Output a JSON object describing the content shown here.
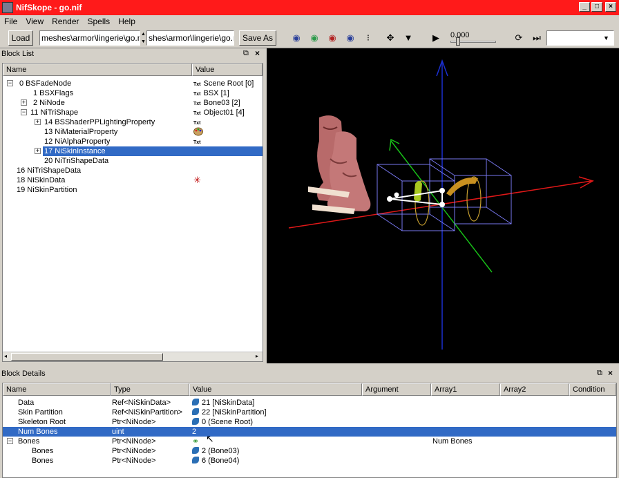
{
  "window": {
    "title": "NifSkope - go.nif"
  },
  "menu": [
    "File",
    "View",
    "Render",
    "Spells",
    "Help"
  ],
  "toolbar": {
    "load_label": "Load",
    "load_path": "meshes\\armor\\lingerie\\go.nif",
    "save_path": "shes\\armor\\lingerie\\go.nif",
    "save_label": "Save As",
    "time_value": "0.000"
  },
  "block_list": {
    "title": "Block List",
    "columns": [
      "Name",
      "Value"
    ],
    "rows": [
      {
        "name": "0  BSFadeNode",
        "value": "Scene Root [0]",
        "tag": "Txt"
      },
      {
        "name": "1  BSXFlags",
        "value": "BSX [1]",
        "tag": "Txt"
      },
      {
        "name": "2  NiNode",
        "value": "Bone03 [2]",
        "tag": "Txt"
      },
      {
        "name": "11  NiTriShape",
        "value": "Object01 [4]",
        "tag": "Txt"
      },
      {
        "name": "14  BSShaderPPLightingProperty",
        "value": "",
        "tag": "Txt"
      },
      {
        "name": "13  NiMaterialProperty",
        "value": "",
        "tag": ""
      },
      {
        "name": "12  NiAlphaProperty",
        "value": "",
        "tag": "Txt"
      },
      {
        "name": "17  NiSkinInstance",
        "value": "",
        "tag": ""
      },
      {
        "name": "20  NiTriShapeData",
        "value": "",
        "tag": ""
      },
      {
        "name": "16  NiTriShapeData",
        "value": "",
        "tag": ""
      },
      {
        "name": "18  NiSkinData",
        "value": "",
        "tag": ""
      },
      {
        "name": "19  NiSkinPartition",
        "value": "",
        "tag": ""
      }
    ]
  },
  "block_details": {
    "title": "Block Details",
    "columns": [
      "Name",
      "Type",
      "Value",
      "Argument",
      "Array1",
      "Array2",
      "Condition"
    ],
    "rows": [
      {
        "name": "Data",
        "type": "Ref<NiSkinData>",
        "value": "21 [NiSkinData]",
        "array1": ""
      },
      {
        "name": "Skin Partition",
        "type": "Ref<NiSkinPartition>",
        "value": "22 [NiSkinPartition]",
        "array1": ""
      },
      {
        "name": "Skeleton Root",
        "type": "Ptr<NiNode>",
        "value": "0 (Scene Root)",
        "array1": ""
      },
      {
        "name": "Num Bones",
        "type": "uint",
        "value": "2",
        "array1": ""
      },
      {
        "name": "Bones",
        "type": "Ptr<NiNode>",
        "value": "",
        "array1": "Num Bones"
      },
      {
        "name": "Bones",
        "type": "Ptr<NiNode>",
        "value": "2 (Bone03)",
        "array1": ""
      },
      {
        "name": "Bones",
        "type": "Ptr<NiNode>",
        "value": "6 (Bone04)",
        "array1": ""
      }
    ]
  },
  "colors": {
    "titlebar": "#ff1a1a",
    "selection": "#316ac5",
    "viewport": "#000000"
  }
}
